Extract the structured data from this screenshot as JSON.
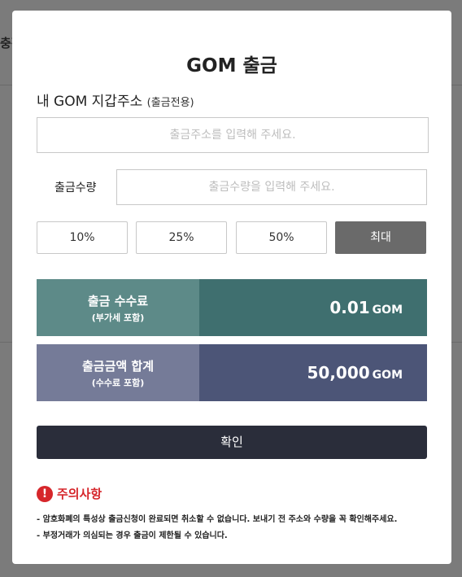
{
  "background": {
    "fragment_text": "충전"
  },
  "modal": {
    "title": "GOM 출금",
    "address": {
      "label": "내 GOM 지갑주소",
      "label_note": "(출금전용)",
      "placeholder": "출금주소를 입력해 주세요.",
      "value": ""
    },
    "amount": {
      "label": "출금수량",
      "placeholder": "출금수량을 입력해 주세요.",
      "value": ""
    },
    "percent_buttons": [
      "10%",
      "25%",
      "50%",
      "최대"
    ],
    "fee": {
      "label": "출금 수수료",
      "sub": "(부가세 포함)",
      "value": "0.01",
      "unit": "GOM"
    },
    "total": {
      "label": "출금금액 합계",
      "sub": "(수수료 포함)",
      "value": "50,000",
      "unit": "GOM"
    },
    "confirm_label": "확인",
    "notice": {
      "icon": "!",
      "title": "주의사항",
      "lines": [
        "- 암호화폐의 특성상 출금신청이 완료되면 취소할 수 없습니다. 보내기 전 주소와 수량을 꼭 확인해주세요.",
        "- 부정거래가 의심되는 경우 출금이 제한될 수 있습니다."
      ]
    }
  },
  "colors": {
    "fee_label_bg": "#5d8a88",
    "fee_value_bg": "#3f6f6f",
    "total_label_bg": "#757b98",
    "total_value_bg": "#4c5577",
    "confirm_bg": "#2a2d3a",
    "max_button_bg": "#6a6a6a",
    "notice_red": "#d6262b"
  }
}
